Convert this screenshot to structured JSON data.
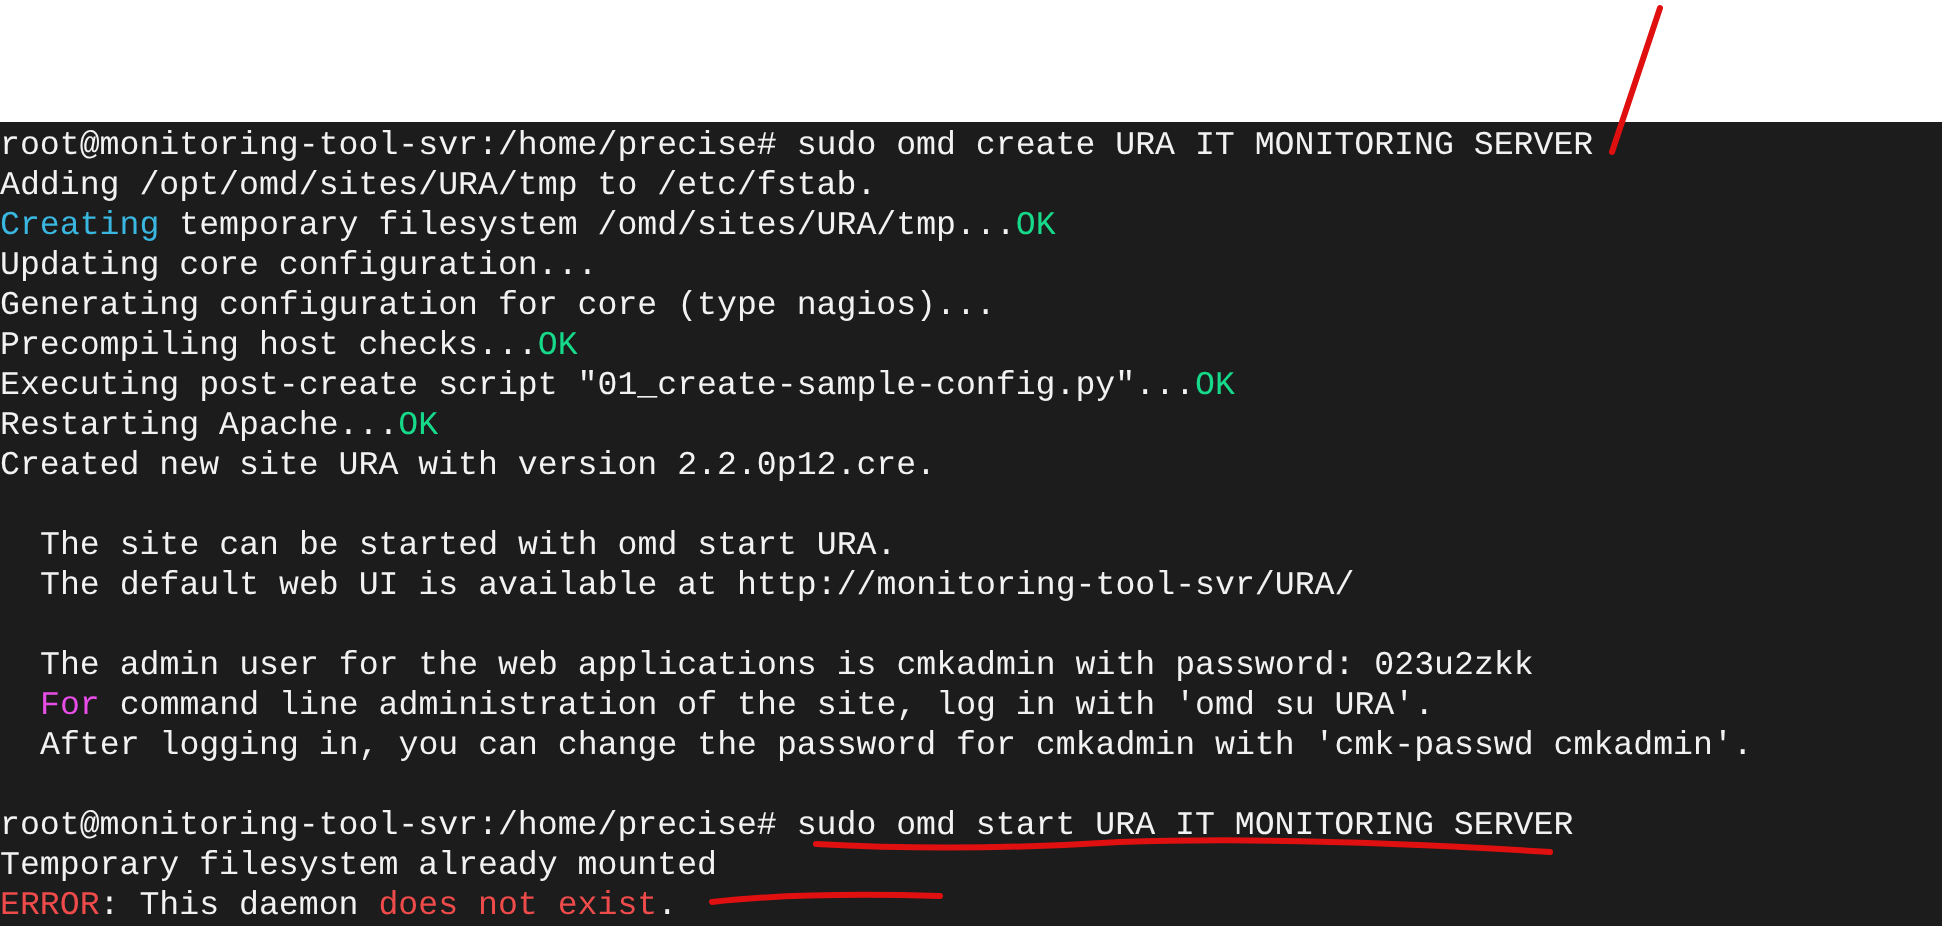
{
  "terminal": {
    "lines": [
      {
        "kind": "text",
        "indented": false,
        "segments": [
          {
            "kind": "plain",
            "text": "root@monitoring-tool-svr:/home/precise# sudo omd create URA IT MONITORING SERVER"
          }
        ]
      },
      {
        "kind": "text",
        "indented": false,
        "segments": [
          {
            "kind": "plain",
            "text": "Adding /opt/omd/sites/URA/tmp to /etc/fstab."
          }
        ]
      },
      {
        "kind": "text",
        "indented": false,
        "segments": [
          {
            "kind": "info",
            "text": "Creating"
          },
          {
            "kind": "plain",
            "text": " temporary filesystem /omd/sites/URA/tmp..."
          },
          {
            "kind": "ok",
            "text": "OK"
          }
        ]
      },
      {
        "kind": "text",
        "indented": false,
        "segments": [
          {
            "kind": "plain",
            "text": "Updating core configuration..."
          }
        ]
      },
      {
        "kind": "text",
        "indented": false,
        "segments": [
          {
            "kind": "plain",
            "text": "Generating configuration for core (type nagios)..."
          }
        ]
      },
      {
        "kind": "text",
        "indented": false,
        "segments": [
          {
            "kind": "plain",
            "text": "Precompiling host checks..."
          },
          {
            "kind": "ok",
            "text": "OK"
          }
        ]
      },
      {
        "kind": "text",
        "indented": false,
        "segments": [
          {
            "kind": "plain",
            "text": "Executing post-create script \"01_create-sample-config.py\"..."
          },
          {
            "kind": "ok",
            "text": "OK"
          }
        ]
      },
      {
        "kind": "text",
        "indented": false,
        "segments": [
          {
            "kind": "plain",
            "text": "Restarting Apache..."
          },
          {
            "kind": "ok",
            "text": "OK"
          }
        ]
      },
      {
        "kind": "text",
        "indented": false,
        "segments": [
          {
            "kind": "plain",
            "text": "Created new site URA with version 2.2.0p12.cre."
          }
        ]
      },
      {
        "kind": "blank"
      },
      {
        "kind": "text",
        "indented": true,
        "segments": [
          {
            "kind": "plain",
            "text": "The site can be started with omd start URA."
          }
        ]
      },
      {
        "kind": "text",
        "indented": true,
        "segments": [
          {
            "kind": "plain",
            "text": "The default web UI is available at http://monitoring-tool-svr/URA/"
          }
        ]
      },
      {
        "kind": "blank"
      },
      {
        "kind": "text",
        "indented": true,
        "segments": [
          {
            "kind": "plain",
            "text": "The admin user for the web applications is cmkadmin with password: 023u2zkk"
          }
        ]
      },
      {
        "kind": "text",
        "indented": true,
        "segments": [
          {
            "kind": "emphasis",
            "text": "For"
          },
          {
            "kind": "plain",
            "text": " command line administration of the site, log in with 'omd su URA'."
          }
        ]
      },
      {
        "kind": "text",
        "indented": true,
        "segments": [
          {
            "kind": "plain",
            "text": "After logging in, you can change the password for cmkadmin with 'cmk-passwd cmkadmin'."
          }
        ]
      },
      {
        "kind": "blank"
      },
      {
        "kind": "text",
        "indented": false,
        "segments": [
          {
            "kind": "plain",
            "text": "root@monitoring-tool-svr:/home/precise# sudo omd start URA IT MONITORING SERVER"
          }
        ]
      },
      {
        "kind": "text",
        "indented": false,
        "segments": [
          {
            "kind": "plain",
            "text": "Temporary filesystem already mounted"
          }
        ]
      },
      {
        "kind": "text",
        "indented": false,
        "segments": [
          {
            "kind": "error",
            "text": "ERROR"
          },
          {
            "kind": "plain",
            "text": ": This daemon "
          },
          {
            "kind": "error",
            "text": "does not exist"
          },
          {
            "kind": "plain",
            "text": "."
          }
        ]
      }
    ]
  }
}
